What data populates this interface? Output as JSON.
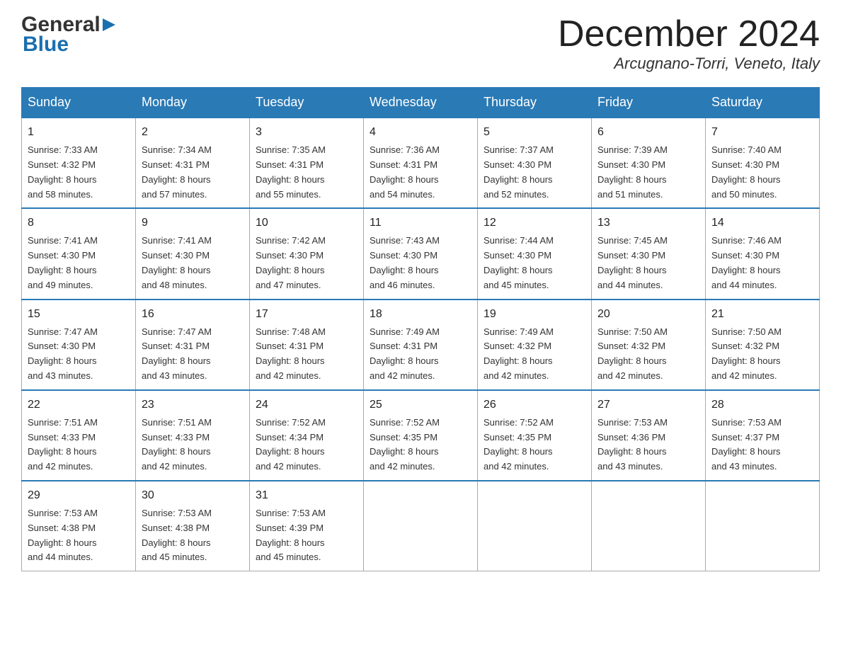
{
  "header": {
    "logo_line1": "General",
    "logo_line2": "Blue",
    "month_year": "December 2024",
    "location": "Arcugnano-Torri, Veneto, Italy"
  },
  "days_of_week": [
    "Sunday",
    "Monday",
    "Tuesday",
    "Wednesday",
    "Thursday",
    "Friday",
    "Saturday"
  ],
  "weeks": [
    [
      {
        "day": "1",
        "sunrise": "7:33 AM",
        "sunset": "4:32 PM",
        "daylight": "8 hours and 58 minutes."
      },
      {
        "day": "2",
        "sunrise": "7:34 AM",
        "sunset": "4:31 PM",
        "daylight": "8 hours and 57 minutes."
      },
      {
        "day": "3",
        "sunrise": "7:35 AM",
        "sunset": "4:31 PM",
        "daylight": "8 hours and 55 minutes."
      },
      {
        "day": "4",
        "sunrise": "7:36 AM",
        "sunset": "4:31 PM",
        "daylight": "8 hours and 54 minutes."
      },
      {
        "day": "5",
        "sunrise": "7:37 AM",
        "sunset": "4:30 PM",
        "daylight": "8 hours and 52 minutes."
      },
      {
        "day": "6",
        "sunrise": "7:39 AM",
        "sunset": "4:30 PM",
        "daylight": "8 hours and 51 minutes."
      },
      {
        "day": "7",
        "sunrise": "7:40 AM",
        "sunset": "4:30 PM",
        "daylight": "8 hours and 50 minutes."
      }
    ],
    [
      {
        "day": "8",
        "sunrise": "7:41 AM",
        "sunset": "4:30 PM",
        "daylight": "8 hours and 49 minutes."
      },
      {
        "day": "9",
        "sunrise": "7:41 AM",
        "sunset": "4:30 PM",
        "daylight": "8 hours and 48 minutes."
      },
      {
        "day": "10",
        "sunrise": "7:42 AM",
        "sunset": "4:30 PM",
        "daylight": "8 hours and 47 minutes."
      },
      {
        "day": "11",
        "sunrise": "7:43 AM",
        "sunset": "4:30 PM",
        "daylight": "8 hours and 46 minutes."
      },
      {
        "day": "12",
        "sunrise": "7:44 AM",
        "sunset": "4:30 PM",
        "daylight": "8 hours and 45 minutes."
      },
      {
        "day": "13",
        "sunrise": "7:45 AM",
        "sunset": "4:30 PM",
        "daylight": "8 hours and 44 minutes."
      },
      {
        "day": "14",
        "sunrise": "7:46 AM",
        "sunset": "4:30 PM",
        "daylight": "8 hours and 44 minutes."
      }
    ],
    [
      {
        "day": "15",
        "sunrise": "7:47 AM",
        "sunset": "4:30 PM",
        "daylight": "8 hours and 43 minutes."
      },
      {
        "day": "16",
        "sunrise": "7:47 AM",
        "sunset": "4:31 PM",
        "daylight": "8 hours and 43 minutes."
      },
      {
        "day": "17",
        "sunrise": "7:48 AM",
        "sunset": "4:31 PM",
        "daylight": "8 hours and 42 minutes."
      },
      {
        "day": "18",
        "sunrise": "7:49 AM",
        "sunset": "4:31 PM",
        "daylight": "8 hours and 42 minutes."
      },
      {
        "day": "19",
        "sunrise": "7:49 AM",
        "sunset": "4:32 PM",
        "daylight": "8 hours and 42 minutes."
      },
      {
        "day": "20",
        "sunrise": "7:50 AM",
        "sunset": "4:32 PM",
        "daylight": "8 hours and 42 minutes."
      },
      {
        "day": "21",
        "sunrise": "7:50 AM",
        "sunset": "4:32 PM",
        "daylight": "8 hours and 42 minutes."
      }
    ],
    [
      {
        "day": "22",
        "sunrise": "7:51 AM",
        "sunset": "4:33 PM",
        "daylight": "8 hours and 42 minutes."
      },
      {
        "day": "23",
        "sunrise": "7:51 AM",
        "sunset": "4:33 PM",
        "daylight": "8 hours and 42 minutes."
      },
      {
        "day": "24",
        "sunrise": "7:52 AM",
        "sunset": "4:34 PM",
        "daylight": "8 hours and 42 minutes."
      },
      {
        "day": "25",
        "sunrise": "7:52 AM",
        "sunset": "4:35 PM",
        "daylight": "8 hours and 42 minutes."
      },
      {
        "day": "26",
        "sunrise": "7:52 AM",
        "sunset": "4:35 PM",
        "daylight": "8 hours and 42 minutes."
      },
      {
        "day": "27",
        "sunrise": "7:53 AM",
        "sunset": "4:36 PM",
        "daylight": "8 hours and 43 minutes."
      },
      {
        "day": "28",
        "sunrise": "7:53 AM",
        "sunset": "4:37 PM",
        "daylight": "8 hours and 43 minutes."
      }
    ],
    [
      {
        "day": "29",
        "sunrise": "7:53 AM",
        "sunset": "4:38 PM",
        "daylight": "8 hours and 44 minutes."
      },
      {
        "day": "30",
        "sunrise": "7:53 AM",
        "sunset": "4:38 PM",
        "daylight": "8 hours and 45 minutes."
      },
      {
        "day": "31",
        "sunrise": "7:53 AM",
        "sunset": "4:39 PM",
        "daylight": "8 hours and 45 minutes."
      },
      null,
      null,
      null,
      null
    ]
  ],
  "labels": {
    "sunrise": "Sunrise:",
    "sunset": "Sunset:",
    "daylight": "Daylight:"
  }
}
